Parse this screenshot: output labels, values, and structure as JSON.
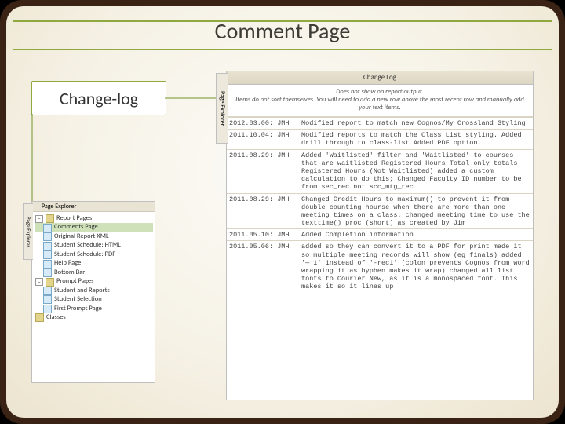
{
  "title": "Comment Page",
  "callout": "Change-log",
  "main": {
    "side_tab": "Page Explorer",
    "header": "Change Log",
    "note_l1": "Does not show on report output.",
    "note_l2": "Items do not sort themselves. You will need to add a new row above the most recent row and manually add your text items.",
    "rows": [
      {
        "d": "2012.03.00: JMH",
        "t": "Modified report to match new Cognos/My Crossland Styling"
      },
      {
        "d": "2011.10.04: JMH",
        "t": "Modified reports to match the Class List styling.\nAdded drill through to class-list\nAdded PDF option."
      },
      {
        "d": "2011.08.29: JMH",
        "t": "Added 'Waitlisted' filter and 'Waitlisted' to courses that are waitlisted\nRegistered Hours Total only totals Registered Hours (Not Waitlisted) added a custom calculation to do this;\nChanged Faculty ID number to be from sec_rec not scc_mtg_rec"
      },
      {
        "d": "2011.08.29: JMH",
        "t": "Changed Credit Hours to maximum() to prevent it from double counting hourse when there are more than one meeting times on a class.\nchanged meeting time to use the texttime() proc (short) as created by Jim"
      },
      {
        "d": "2011.05.10: JMH",
        "t": "Added Completion information"
      },
      {
        "d": "2011.05.06: JMH",
        "t": "added so they can convert it to a PDF for print\nmade it so multiple meeting records will show (eg finals)\nadded '— 1' instead of '-rec1' (colon prevents Cognos from word wrapping it as hyphen makes it wrap)\nchanged all list fonts to Courier New, as it is a monospaced font. This makes it so it lines up"
      }
    ]
  },
  "explorer": {
    "side_tab": "Page Explorer",
    "header": "Page Explorer",
    "root": "Report Pages",
    "items": [
      "Comments Page",
      "Original Report XML",
      "Student Schedule: HTML",
      "Student Schedule: PDF",
      "Help Page",
      "Bottom Bar"
    ],
    "group2": "Prompt Pages",
    "items2": [
      "Student and Reports",
      "Student Selection",
      "First Prompt Page"
    ],
    "classes": "Classes"
  }
}
